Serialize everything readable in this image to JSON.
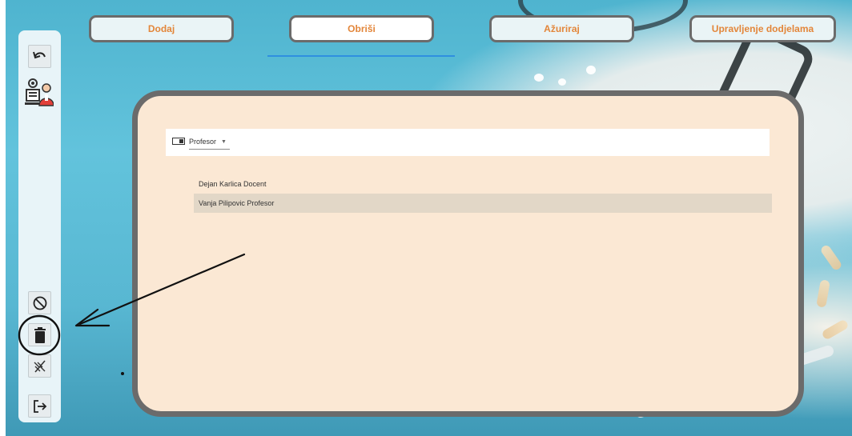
{
  "tabs": [
    {
      "label": "Dodaj"
    },
    {
      "label": "Obriši"
    },
    {
      "label": "Ažuriraj"
    },
    {
      "label": "Upravljenje dodjelama"
    }
  ],
  "sidebar": {
    "icons": [
      "back-icon",
      "admin-user-icon",
      "block-icon",
      "trash-icon",
      "no-filter-icon",
      "logout-icon"
    ]
  },
  "filter": {
    "selected": "Profesor"
  },
  "list": {
    "items": [
      {
        "label": "Dejan Karlica Docent"
      },
      {
        "label": "Vanja Pilipovic Profesor"
      }
    ],
    "selected_index": 1
  },
  "colors": {
    "tab_text": "#e3863a",
    "panel_bg": "#fbe8d4",
    "panel_border": "#6b6b6b",
    "active_underline": "#2f8fe0",
    "selected_row": "#e2d7c7"
  }
}
